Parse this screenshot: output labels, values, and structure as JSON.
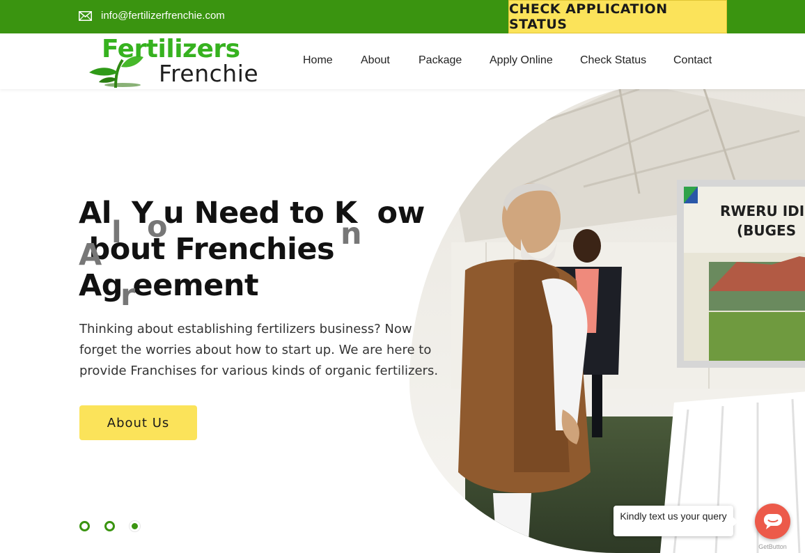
{
  "topbar": {
    "email": "info@fertilizerfrenchie.com",
    "status_button": "CHECK APPLICATION STATUS"
  },
  "logo": {
    "line1": "Fertilizers",
    "line2": "Frenchie"
  },
  "nav": [
    {
      "label": "Home"
    },
    {
      "label": "About"
    },
    {
      "label": "Package"
    },
    {
      "label": "Apply Online"
    },
    {
      "label": "Check Status"
    },
    {
      "label": "Contact"
    }
  ],
  "hero": {
    "title_line1": "Al  Y u Need to K  ow",
    "title_line2": " bout Frenchies",
    "title_line3": "Ag eement",
    "ghost_letters": [
      "l",
      "o",
      "n",
      "A",
      "r"
    ],
    "text": "Thinking about establishing fertilizers business? Now forget the worries about how to start up. We are here to provide Franchises for various kinds of organic fertilizers.",
    "button": "About Us",
    "screen_text_1": "RWERU IDI",
    "screen_text_2": "(BUGES",
    "slides": 3,
    "active_slide": 3
  },
  "chat": {
    "prompt": "Kindly text us your query",
    "brand": "GetButton"
  },
  "colors": {
    "green": "#3a9410",
    "yellow": "#fbe35a",
    "chat_red": "#ec5a4a"
  },
  "icons": [
    "mail-icon",
    "sprout-icon",
    "chat-icon"
  ]
}
